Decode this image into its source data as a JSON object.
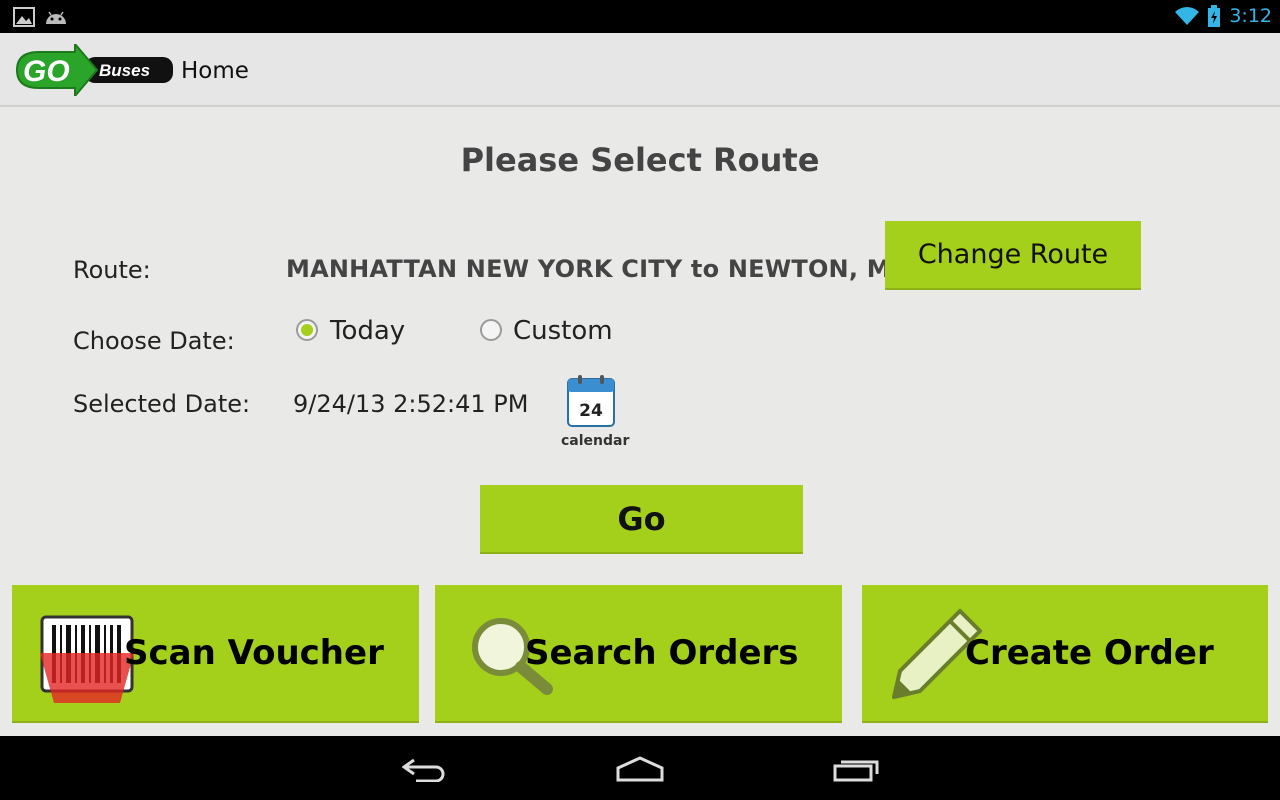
{
  "status_bar": {
    "time": "3:12"
  },
  "action_bar": {
    "logo_text_go": "GO",
    "logo_text_buses": "Buses",
    "title": "Home"
  },
  "main": {
    "heading": "Please Select Route",
    "route_label": "Route:",
    "route_value": "MANHATTAN NEW YORK CITY to NEWTON, MA",
    "change_route_label": "Change Route",
    "choose_date_label": "Choose Date:",
    "date_options": [
      {
        "label": "Today",
        "selected": true
      },
      {
        "label": "Custom",
        "selected": false
      }
    ],
    "selected_date_label": "Selected Date:",
    "selected_date_value": "9/24/13 2:52:41 PM",
    "calendar_day": "24",
    "calendar_label": "calendar",
    "go_label": "Go"
  },
  "actions": [
    {
      "label": "Scan Voucher",
      "icon": "barcode-scanner-icon"
    },
    {
      "label": "Search Orders",
      "icon": "magnifier-icon"
    },
    {
      "label": "Create Order",
      "icon": "pencil-icon"
    }
  ],
  "colors": {
    "accent": "#a4cf1b",
    "status_blue": "#33b5e5"
  }
}
